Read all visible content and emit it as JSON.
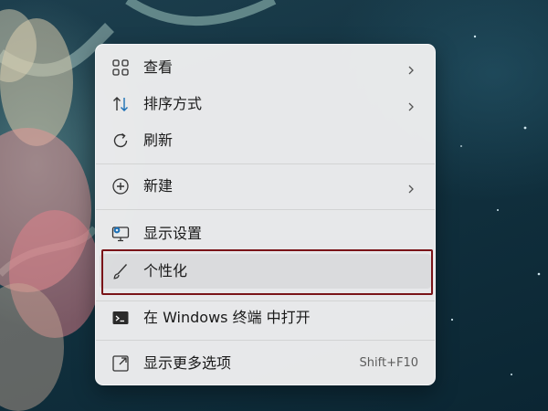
{
  "context_menu": {
    "items": [
      {
        "label": "查看",
        "icon": "grid-view-icon",
        "has_submenu": true
      },
      {
        "label": "排序方式",
        "icon": "sort-arrows-icon",
        "has_submenu": true
      },
      {
        "label": "刷新",
        "icon": "refresh-icon",
        "has_submenu": false
      },
      {
        "label": "新建",
        "icon": "plus-circle-icon",
        "has_submenu": true
      },
      {
        "label": "显示设置",
        "icon": "display-settings-icon",
        "has_submenu": false
      },
      {
        "label": "个性化",
        "icon": "brush-icon",
        "has_submenu": false,
        "highlighted": true
      },
      {
        "label": "在 Windows 终端 中打开",
        "icon": "terminal-icon",
        "has_submenu": false
      },
      {
        "label": "显示更多选项",
        "icon": "more-options-icon",
        "has_submenu": false,
        "shortcut": "Shift+F10"
      }
    ]
  },
  "colors": {
    "menu_background": "#eeeef0",
    "text": "#1a1a1a",
    "highlight_frame": "#7a1418",
    "icon_accent": "#1a6fb5"
  }
}
